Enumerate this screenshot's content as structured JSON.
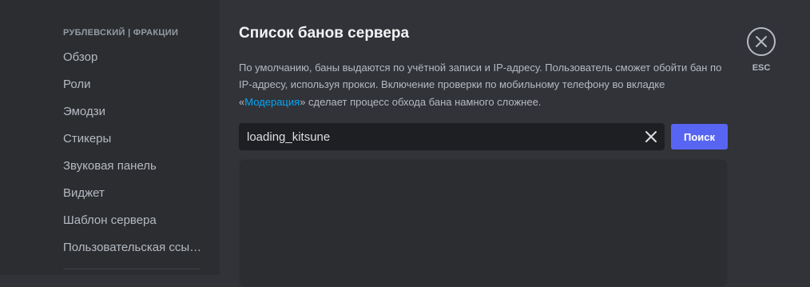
{
  "sidebar": {
    "server_header": "РУБЛЕВСКИЙ | ФРАКЦИИ",
    "items": [
      {
        "label": "Обзор"
      },
      {
        "label": "Роли"
      },
      {
        "label": "Эмодзи"
      },
      {
        "label": "Стикеры"
      },
      {
        "label": "Звуковая панель"
      },
      {
        "label": "Виджет"
      },
      {
        "label": "Шаблон сервера"
      },
      {
        "label": "Пользовательская ссылка"
      }
    ]
  },
  "main": {
    "title": "Список банов сервера",
    "description_part1": "По умолчанию, баны выдаются по учётной записи и IP-адресу. Пользователь сможет обойти бан по IP-адресу, используя прокси. Включение проверки по мобильному телефону во вкладке «",
    "description_link": "Модерация",
    "description_part2": "» сделает процесс обхода бана намного сложнее.",
    "search": {
      "value": "loading_kitsune",
      "button_label": "Поиск"
    }
  },
  "close": {
    "label": "ESC"
  },
  "icons": {
    "clear": "x-icon",
    "close": "close-circle-icon"
  },
  "colors": {
    "accent": "#5865f2",
    "link": "#00a8fc"
  }
}
